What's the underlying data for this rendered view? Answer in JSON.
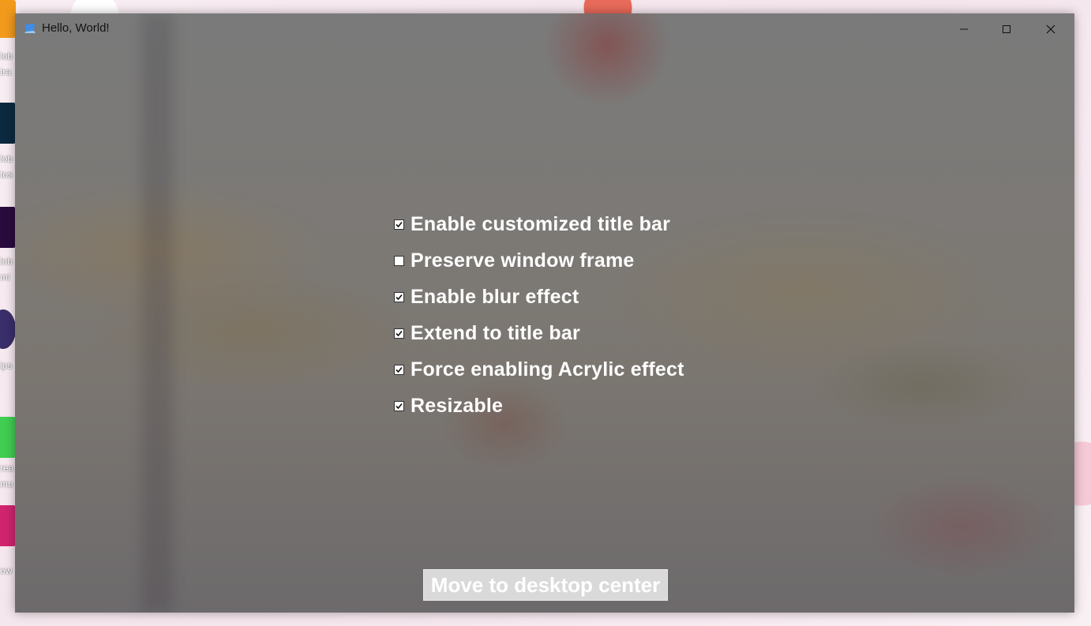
{
  "window": {
    "title": "Hello, World!",
    "caption_buttons": {
      "minimize": "minimize-icon",
      "maximize": "maximize-icon",
      "close": "close-icon"
    }
  },
  "options": [
    {
      "label": "Enable customized title bar",
      "checked": true
    },
    {
      "label": "Preserve window frame",
      "checked": false
    },
    {
      "label": "Enable blur effect",
      "checked": true
    },
    {
      "label": "Extend to title bar",
      "checked": true
    },
    {
      "label": "Force enabling Acrylic effect",
      "checked": true
    },
    {
      "label": "Resizable",
      "checked": true
    }
  ],
  "actions": {
    "move_center_label": "Move to desktop center"
  },
  "desktop": {
    "visible_labels": [
      "lob",
      "tra",
      "lob",
      "tos",
      "lob",
      "mi",
      "ips",
      "rea",
      "mu",
      "ow"
    ]
  },
  "colors": {
    "window_tint": "#7a7a7a",
    "label_text": "#ffffff",
    "title_text": "#111111",
    "button_bg": "#d9d9d9"
  }
}
